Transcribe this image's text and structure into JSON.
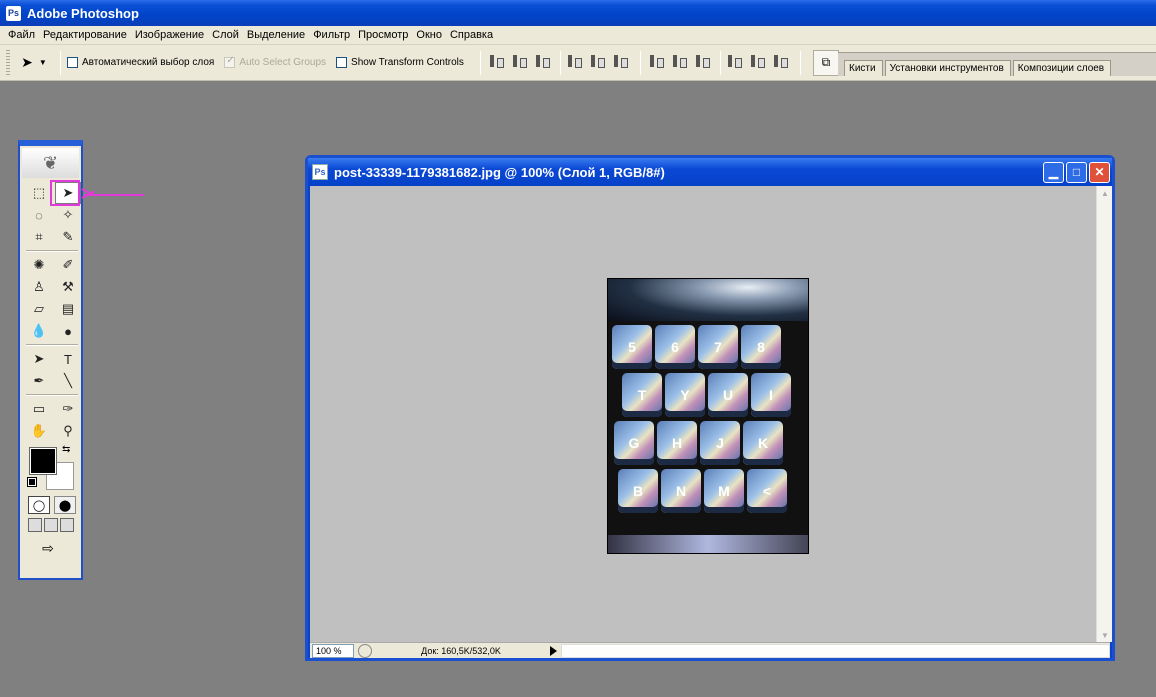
{
  "app": {
    "title": "Adobe Photoshop"
  },
  "menu": [
    {
      "label": "Файл",
      "key": "Ф"
    },
    {
      "label": "Редактирование",
      "key": "Р"
    },
    {
      "label": "Изображение",
      "key": "И"
    },
    {
      "label": "Слой",
      "key": "С"
    },
    {
      "label": "Выделение",
      "key": "В"
    },
    {
      "label": "Фильтр",
      "key": "л"
    },
    {
      "label": "Просмотр",
      "key": "П"
    },
    {
      "label": "Окно",
      "key": "О"
    },
    {
      "label": "Справка",
      "key": "С"
    }
  ],
  "options": {
    "auto_select_label": "Автоматический выбор слоя",
    "auto_select_groups_label": "Auto Select Groups",
    "show_transform_label": "Show Transform Controls"
  },
  "palette_well": {
    "tabs": [
      "Кисти",
      "Установки инструментов",
      "Композиции слоев"
    ]
  },
  "document": {
    "title": "post-33339-1179381682.jpg @ 100% (Слой 1, RGB/8#)",
    "zoom": "100 %",
    "doc_info": "Док: 160,5K/532,0K",
    "photo_keys": {
      "row1": [
        "5",
        "6",
        "7",
        "8"
      ],
      "row2": [
        "T",
        "Y",
        "U",
        "I"
      ],
      "row3": [
        "G",
        "H",
        "J",
        "K"
      ],
      "row4": [
        "B",
        "N",
        "M",
        "<"
      ]
    }
  },
  "colors": {
    "accent": "#0a43c8",
    "annotation": "#e23ad8"
  }
}
